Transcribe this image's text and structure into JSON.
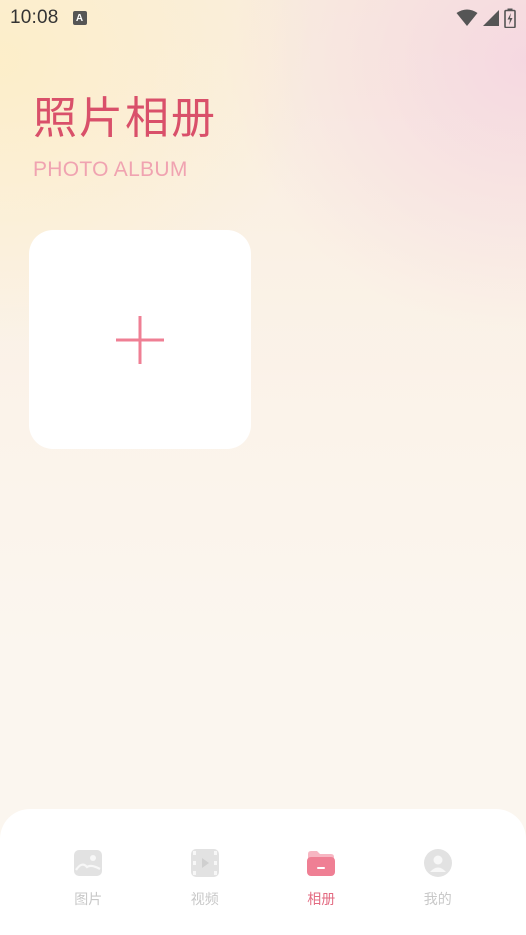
{
  "status_bar": {
    "time": "10:08",
    "notification_icon": "A"
  },
  "header": {
    "title": "照片相册",
    "subtitle": "PHOTO ALBUM"
  },
  "add_card": {
    "icon": "plus-icon"
  },
  "bottom_nav": {
    "items": [
      {
        "label": "图片",
        "icon": "image-icon",
        "active": false
      },
      {
        "label": "视频",
        "icon": "video-icon",
        "active": false
      },
      {
        "label": "相册",
        "icon": "album-folder-icon",
        "active": true
      },
      {
        "label": "我的",
        "icon": "user-icon",
        "active": false
      }
    ]
  },
  "colors": {
    "accent": "#d9506a",
    "accent_light": "#f0a3b1",
    "plus": "#ef7f94",
    "inactive": "#c8c8c8"
  }
}
